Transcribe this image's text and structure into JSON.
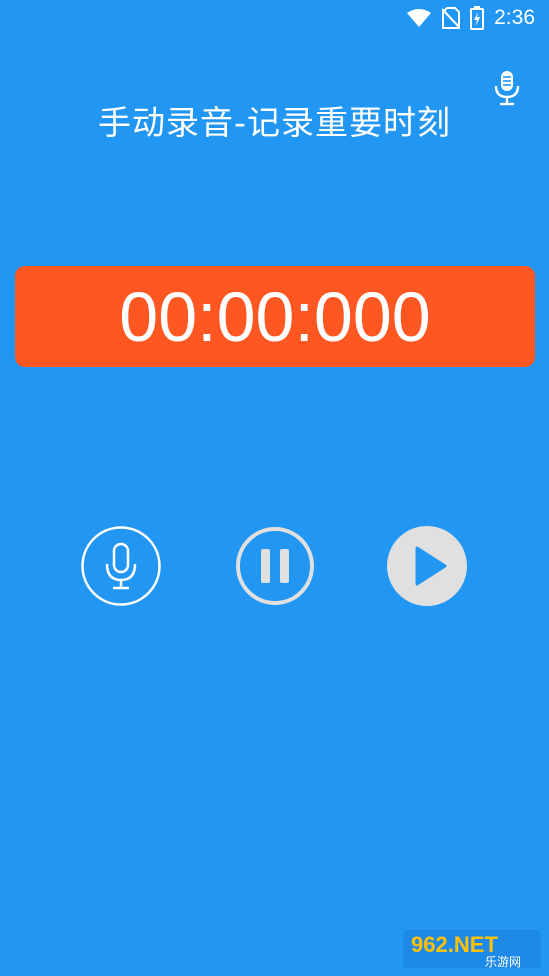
{
  "status_bar": {
    "time": "2:36",
    "icons": [
      "wifi-icon",
      "no-sim-icon",
      "battery-charging-icon"
    ]
  },
  "header": {
    "title": "手动录音-记录重要时刻",
    "action_icon": "microphone-icon"
  },
  "timer": {
    "display": "00:00:000"
  },
  "controls": {
    "record_icon": "microphone-icon",
    "pause_icon": "pause-icon",
    "play_icon": "play-icon"
  },
  "watermark": {
    "line1": "962.NET",
    "line2": "乐游网"
  },
  "colors": {
    "background": "#2196F3",
    "timer_box": "#FF5722",
    "play_button": "#E0E0E0"
  }
}
